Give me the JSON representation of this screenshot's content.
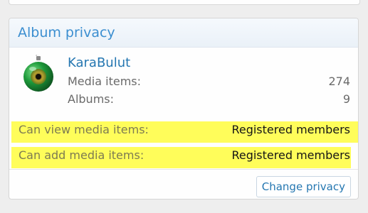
{
  "panel": {
    "title": "Album privacy"
  },
  "user": {
    "name": "KaraBulut",
    "avatar_icon": "green-ornament-eye-avatar"
  },
  "stats": [
    {
      "label": "Media items:",
      "value": "274"
    },
    {
      "label": "Albums:",
      "value": "9"
    }
  ],
  "permissions": [
    {
      "label": "Can view media items:",
      "value": "Registered members"
    },
    {
      "label": "Can add media items:",
      "value": "Registered members"
    }
  ],
  "actions": {
    "change_privacy_label": "Change privacy"
  },
  "colors": {
    "title_blue": "#3b8ed0",
    "link_blue": "#2577b1",
    "highlight_yellow": "#fffd5a"
  }
}
